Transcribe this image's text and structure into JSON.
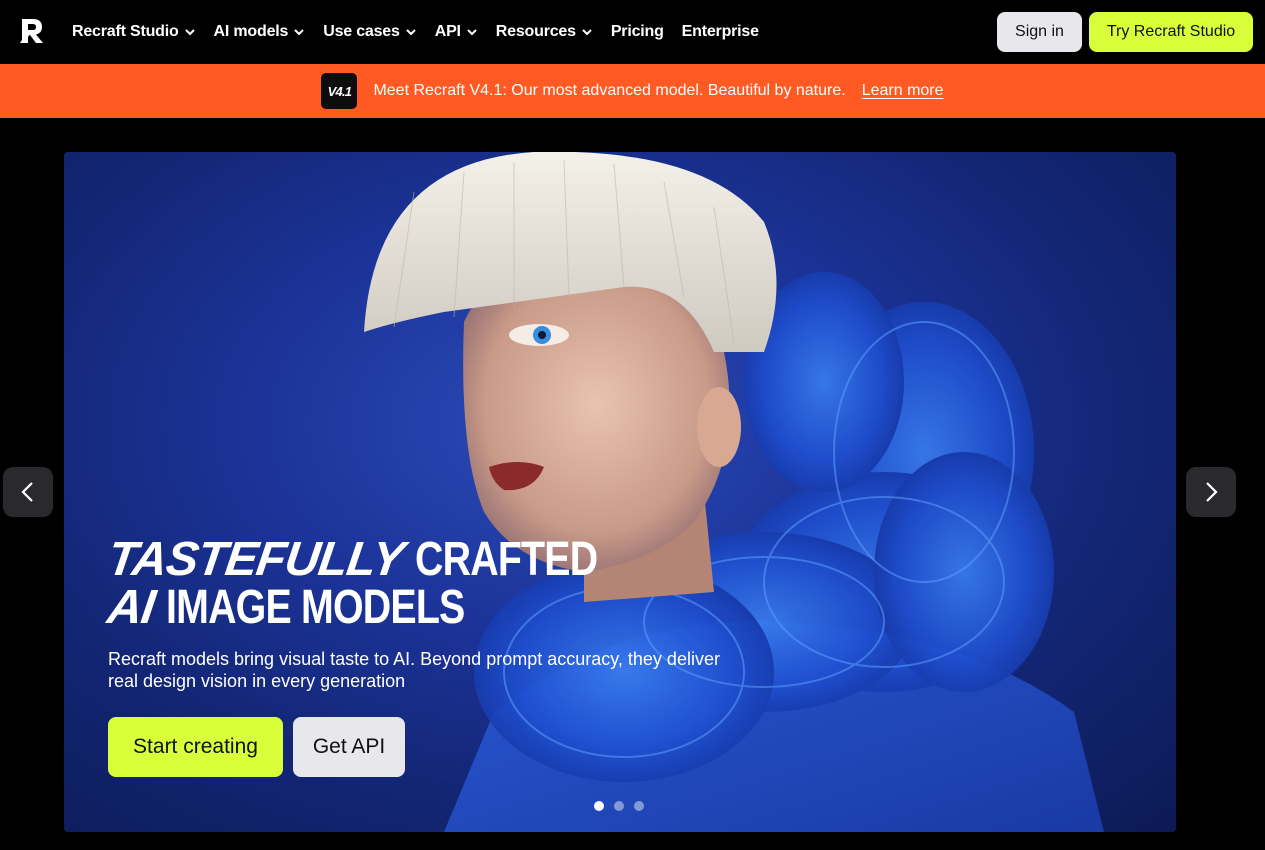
{
  "nav": {
    "items": [
      {
        "label": "Recraft Studio",
        "dropdown": true
      },
      {
        "label": "AI models",
        "dropdown": true
      },
      {
        "label": "Use cases",
        "dropdown": true
      },
      {
        "label": "API",
        "dropdown": true
      },
      {
        "label": "Resources",
        "dropdown": true
      },
      {
        "label": "Pricing",
        "dropdown": false
      },
      {
        "label": "Enterprise",
        "dropdown": false
      }
    ],
    "sign_in": "Sign in",
    "try": "Try Recraft Studio"
  },
  "banner": {
    "badge": "V4.1",
    "text": "Meet Recraft V4.1: Our most advanced model. Beautiful by nature.",
    "link": "Learn more",
    "color": "#ff5a24"
  },
  "hero": {
    "headline_word1": "TASTEFULLY",
    "headline_word2": "CRAFTED",
    "headline_word3": "AI",
    "headline_word4": "IMAGE MODELS",
    "subtitle": "Recraft models bring visual taste to AI. Beyond prompt accuracy, they deliver real design vision in every generation",
    "start": "Start creating",
    "api": "Get API",
    "slides": 3,
    "active_slide": 1
  },
  "colors": {
    "accent": "#d8ff3a",
    "hero_blue": "#1c349a"
  }
}
